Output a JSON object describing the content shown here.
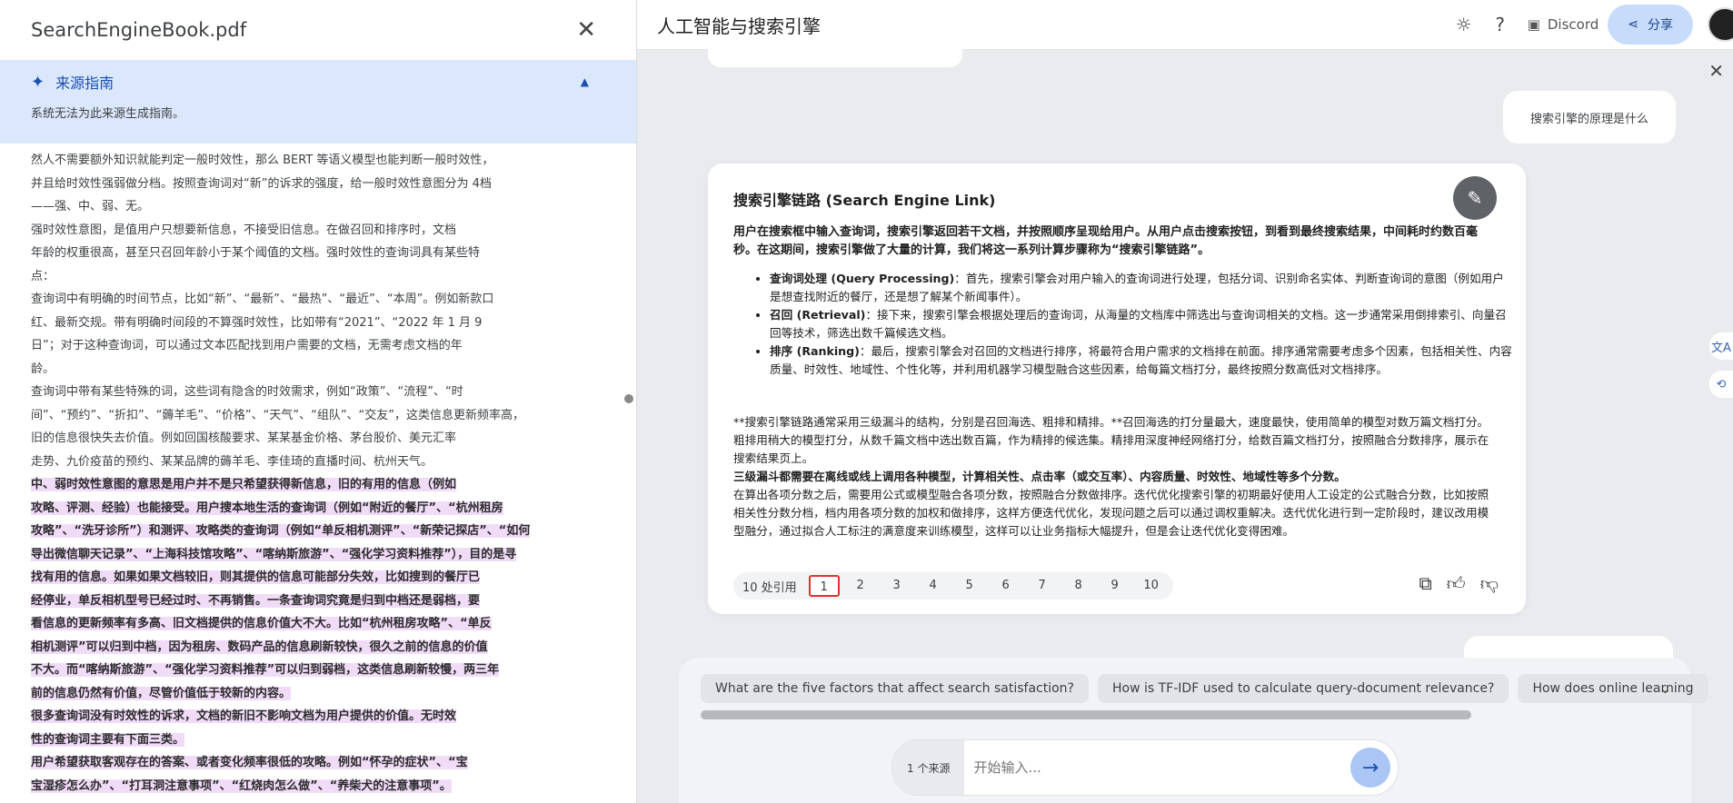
{
  "left_panel": {
    "title": "SearchEngineBook.pdf",
    "close_icon": "close-icon",
    "guide": {
      "title": "来源指南",
      "subtitle": "系统无法为此来源生成指南。"
    },
    "lines": [
      {
        "t": "然人不需要额外知识就能判定一般时效性，那么 BERT 等语义模型也能判断一般时效性，",
        "h": false
      },
      {
        "t": "并且给时效性强弱做分档。按照查询词对“新”的诉求的强度，给一般时效性意图分为 4档",
        "h": false
      },
      {
        "t": "——强、中、弱、无。",
        "h": false
      },
      {
        "t": "强时效性意图，是值用户只想要新信息，不接受旧信息。在做召回和排序时，文档",
        "h": false
      },
      {
        "t": "年龄的权重很高，甚至只召回年龄小于某个阈值的文档。强时效性的查询词具有某些特",
        "h": false
      },
      {
        "t": "点：",
        "h": false
      },
      {
        "t": "查询词中有明确的时间节点，比如“新”、“最新”、“最热”、“最近”、“本周”。例如新款口",
        "h": false
      },
      {
        "t": "红、最新交规。带有明确时间段的不算强时效性，比如带有“2021”、“2022 年 1 月 9",
        "h": false
      },
      {
        "t": "日”；对于这种查询词，可以通过文本匹配找到用户需要的文档，无需考虑文档的年",
        "h": false
      },
      {
        "t": "龄。",
        "h": false
      },
      {
        "t": "查询词中带有某些特殊的词，这些词有隐含的时效需求，例如“政策”、“流程”、“时",
        "h": false
      },
      {
        "t": "间”、“预约”、“折扣”、“薅羊毛”、“价格”、“天气”、“组队”、“交友”，这类信息更新频率高，",
        "h": false
      },
      {
        "t": "旧的信息很快失去价值。例如回国核酸要求、某某基金价格、茅台股价、美元汇率",
        "h": false
      },
      {
        "t": "走势、九价疫苗的预约、某某品牌的薅羊毛、李佳琦的直播时间、杭州天气。",
        "h": false
      },
      {
        "t": "中、弱时效性意图的意思是用户并不是只希望获得新信息，旧的有用的信息（例如",
        "h": true
      },
      {
        "t": "攻略、评测、经验）也能接受。用户搜本地生活的查询词（例如“附近的餐厅”、“杭州租房",
        "h": true
      },
      {
        "t": "攻略”、“洗牙诊所”）和测评、攻略类的查询词（例如“单反相机测评”、“新荣记探店”、“如何",
        "h": true
      },
      {
        "t": "导出微信聊天记录”、“上海科技馆攻略”、“喀纳斯旅游”、“强化学习资料推荐”），目的是寻",
        "h": true
      },
      {
        "t": "找有用的信息。如果如果文档较旧，则其提供的信息可能部分失效，比如搜到的餐厅已",
        "h": true
      },
      {
        "t": "经停业，单反相机型号已经过时、不再销售。一条查询词究竟是归到中档还是弱档，要",
        "h": true
      },
      {
        "t": "看信息的更新频率有多高、旧文档提供的信息价值大不大。比如“杭州租房攻略”、“单反",
        "h": true
      },
      {
        "t": "相机测评”可以归到中档，因为租房、数码产品的信息刷新较快，很久之前的信息的价值",
        "h": true
      },
      {
        "t": "不大。而“喀纳斯旅游”、“强化学习资料推荐”可以归到弱档，这类信息刷新较慢，两三年",
        "h": true
      },
      {
        "t": "前的信息仍然有价值，尽管价值低于较新的内容。",
        "h": true
      },
      {
        "t": "很多查询词没有时效性的诉求，文档的新旧不影响文档为用户提供的价值。无时效",
        "h": true
      },
      {
        "t": "性的查询词主要有下面三类。",
        "h": true
      },
      {
        "t": "用户希望获取客观存在的答案、或者变化频率很低的攻略。例如“怀孕的症状”、“宝",
        "h": true
      },
      {
        "t": "宝湿疹怎么办”、“打耳洞注意事项”、“红烧肉怎么做”、“养柴犬的注意事项”。",
        "h": true
      }
    ]
  },
  "header": {
    "title": "人工智能与搜索引擎",
    "discord": "Discord",
    "share": "分享"
  },
  "chat": {
    "user_question": "搜索引擎的原理是什么",
    "side_buttons": [
      "文A",
      "⟲"
    ],
    "answer": {
      "title": "搜索引擎链路 (Search Engine Link)",
      "intro": "用户在搜索框中输入查询词，搜索引擎返回若干文档，并按照顺序呈现给用户。从用户点击搜索按钮，到看到最终搜索结果，中间耗时约数百毫秒。在这期间，搜索引擎做了大量的计算，我们将这一系列计算步骤称为“搜索引擎链路”。",
      "bullets": [
        {
          "label": "查询词处理 (Query Processing)",
          "text": "：首先，搜索引擎会对用户输入的查询词进行处理，包括分词、识别命名实体、判断查询词的意图（例如用户是想查找附近的餐厅，还是想了解某个新闻事件）。"
        },
        {
          "label": "召回 (Retrieval)",
          "text": "：接下来，搜索引擎会根据处理后的查询词，从海量的文档库中筛选出与查询词相关的文档。这一步通常采用倒排索引、向量召回等技术，筛选出数千篇候选文档。"
        },
        {
          "label": "排序 (Ranking)",
          "text": "：最后，搜索引擎会对召回的文档进行排序，将最符合用户需求的文档排在前面。排序通常需要考虑多个因素，包括相关性、内容质量、时效性、地域性、个性化等，并利用机器学习模型融合这些因素，给每篇文档打分，最终按照分数高低对文档排序。"
        }
      ],
      "para1": "**搜索引擎链路通常采用三级漏斗的结构，分别是召回海选、粗排和精排。**召回海选的打分量最大，速度最快，使用简单的模型对数万篇文档打分。粗排用稍大的模型打分，从数千篇文档中选出数百篇，作为精排的候选集。精排用深度神经网络打分，给数百篇文档打分，按照融合分数排序，展示在搜索结果页上。",
      "para2_bold": "三级漏斗都需要在离线或线上调用各种模型，计算相关性、点击率（或交互率）、内容质量、时效性、地域性等多个分数。",
      "para2": "在算出各项分数之后，需要用公式或模型融合各项分数，按照融合分数做排序。迭代优化搜索引擎的初期最好使用人工设定的公式融合分数，比如按照相关性分数分档，档内用各项分数的加权和做排序，这样方便迭代优化，发现问题之后可以通过调权重解决。迭代优化进行到一定阶段时，建议改用模型融分，通过拟合人工标注的满意度来训练模型，这样可以让业务指标大幅提升，但是会让迭代优化变得困难。",
      "citations_label": "10 处引用",
      "citations": [
        "1",
        "2",
        "3",
        "4",
        "5",
        "6",
        "7",
        "8",
        "9",
        "10"
      ],
      "selected_citation": "1"
    }
  },
  "suggestions": [
    "What are the five factors that affect search satisfaction?",
    "How is TF-IDF used to calculate query-document relevance?",
    "How does online learning"
  ],
  "input": {
    "source_count": "1 个来源",
    "placeholder": "开始输入..."
  }
}
